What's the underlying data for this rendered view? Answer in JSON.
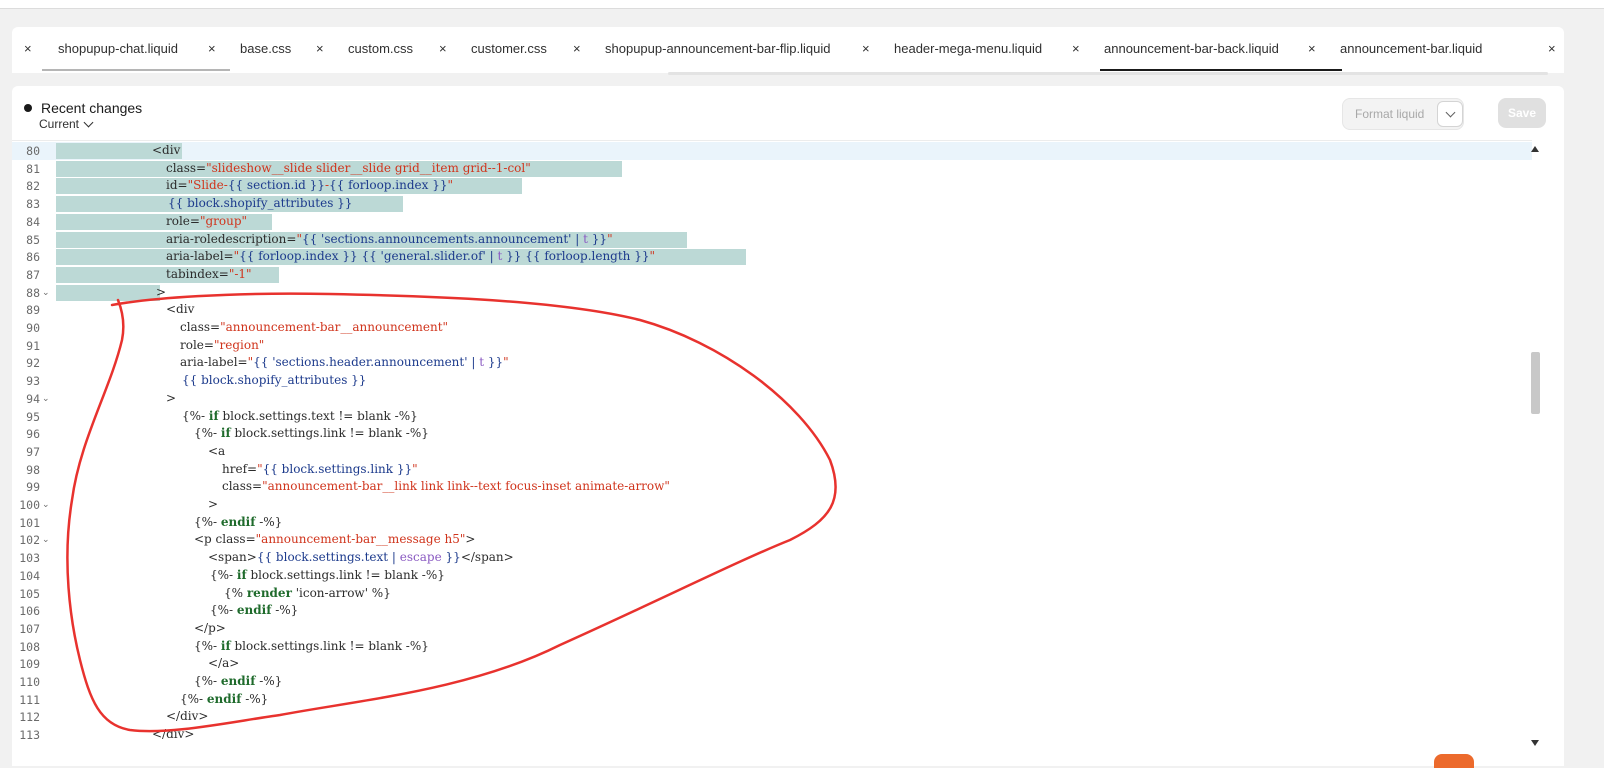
{
  "tabs": [
    {
      "label": "shopupup-chat.liquid",
      "close": "×"
    },
    {
      "label": "base.css",
      "close": "×"
    },
    {
      "label": "custom.css",
      "close": "×"
    },
    {
      "label": "customer.css",
      "close": "×"
    },
    {
      "label": "shopupup-announcement-bar-flip.liquid",
      "close": "×"
    },
    {
      "label": "header-mega-menu.liquid",
      "close": "×"
    },
    {
      "label": "announcement-bar-back.liquid",
      "close": "×",
      "active": true
    },
    {
      "label": "announcement-bar.liquid",
      "close": "×"
    }
  ],
  "editor": {
    "recent_changes": "Recent changes",
    "version_select": "Current",
    "format_button": "Format liquid",
    "save_button": "Save"
  },
  "colors": {
    "selection": "#bcd9d6",
    "annotation": "#e8322e",
    "string": "#d0341c",
    "variable": "#1c3a8c",
    "keyword": "#1f6b2c",
    "filter": "#8a5ac2"
  },
  "code_lines": [
    {
      "n": "80",
      "t": "<div"
    },
    {
      "n": "81",
      "t": "class=\"slideshow__slide slider__slide grid__item grid--1-col\""
    },
    {
      "n": "82",
      "t": "id=\"Slide-{{ section.id }}-{{ forloop.index }}\""
    },
    {
      "n": "83",
      "t": "{{ block.shopify_attributes }}"
    },
    {
      "n": "84",
      "t": "role=\"group\""
    },
    {
      "n": "85",
      "t": "aria-roledescription=\"{{ 'sections.announcements.announcement' | t }}\""
    },
    {
      "n": "86",
      "t": "aria-label=\"{{ forloop.index }} {{ 'general.slider.of' | t }} {{ forloop.length }}\""
    },
    {
      "n": "87",
      "t": "tabindex=\"-1\""
    },
    {
      "n": "88",
      "t": ">"
    },
    {
      "n": "89",
      "t": "<div"
    },
    {
      "n": "90",
      "t": "class=\"announcement-bar__announcement\""
    },
    {
      "n": "91",
      "t": "role=\"region\""
    },
    {
      "n": "92",
      "t": "aria-label=\"{{ 'sections.header.announcement' | t }}\""
    },
    {
      "n": "93",
      "t": "{{ block.shopify_attributes }}"
    },
    {
      "n": "94",
      "t": ">"
    },
    {
      "n": "95",
      "t": "{%- if block.settings.text != blank -%}"
    },
    {
      "n": "96",
      "t": "{%- if block.settings.link != blank -%}"
    },
    {
      "n": "97",
      "t": "<a"
    },
    {
      "n": "98",
      "t": "href=\"{{ block.settings.link }}\""
    },
    {
      "n": "99",
      "t": "class=\"announcement-bar__link link link--text focus-inset animate-arrow\""
    },
    {
      "n": "100",
      "t": ">"
    },
    {
      "n": "101",
      "t": "{%- endif -%}"
    },
    {
      "n": "102",
      "t": "<p class=\"announcement-bar__message h5\">"
    },
    {
      "n": "103",
      "t": "<span>{{ block.settings.text | escape }}</span>"
    },
    {
      "n": "104",
      "t": "{%- if block.settings.link != blank -%}"
    },
    {
      "n": "105",
      "t": "{% render 'icon-arrow' %}"
    },
    {
      "n": "106",
      "t": "{%- endif -%}"
    },
    {
      "n": "107",
      "t": "</p>"
    },
    {
      "n": "108",
      "t": "{%- if block.settings.link != blank -%}"
    },
    {
      "n": "109",
      "t": "</a>"
    },
    {
      "n": "110",
      "t": "{%- endif -%}"
    },
    {
      "n": "111",
      "t": "{%- endif -%}"
    },
    {
      "n": "112",
      "t": "</div>"
    },
    {
      "n": "113",
      "t": "</div>"
    }
  ]
}
